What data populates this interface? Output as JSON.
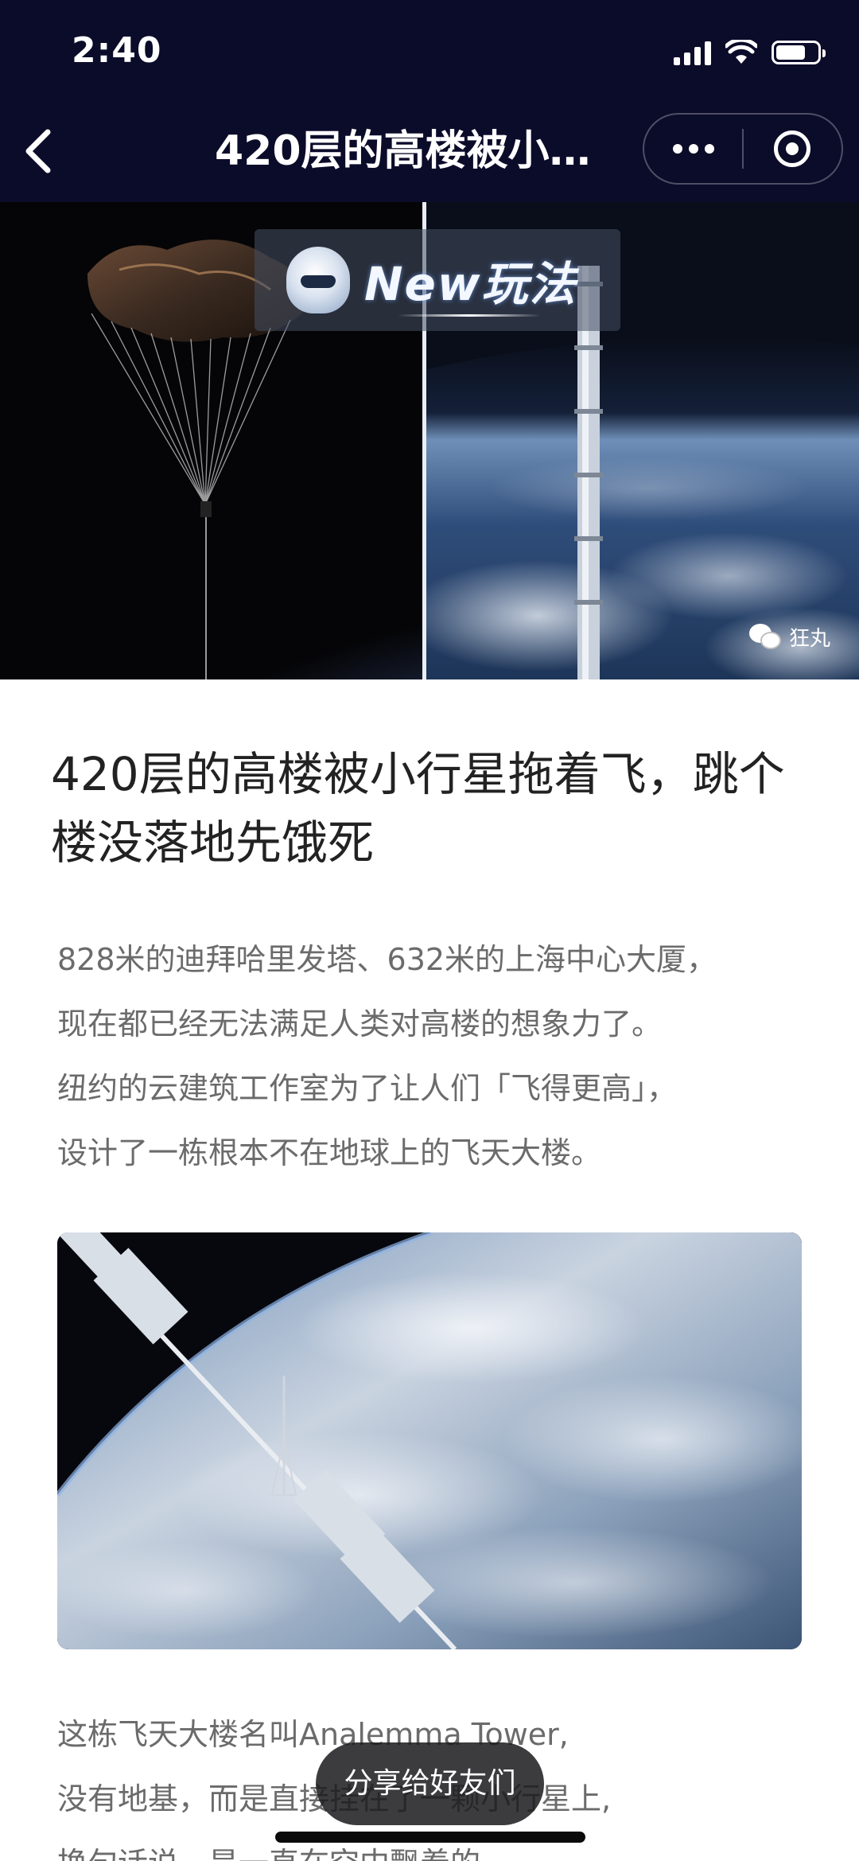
{
  "status_bar": {
    "time": "2:40",
    "icons": [
      "cellular-signal-icon",
      "wifi-icon",
      "battery-icon"
    ]
  },
  "nav": {
    "back_icon": "chevron-left-icon",
    "title": "420层的高楼被小…",
    "more_icon": "more-dots-icon",
    "close_icon": "target-circle-icon"
  },
  "hero": {
    "badge_text": "New玩法",
    "watermark": "狂丸"
  },
  "article": {
    "title": "420层的高楼被小行星拖着飞，跳个楼没落地先饿死",
    "paragraph1": [
      "828米的迪拜哈里发塔、632米的上海中心大厦，",
      "现在都已经无法满足人类对高楼的想象力了。",
      "纽约的云建筑工作室为了让人们「飞得更高」，",
      "设计了一栋根本不在地球上的飞天大楼。"
    ],
    "paragraph2": [
      "这栋飞天大楼名叫Analemma Tower,",
      "没有地基，而是直接挂在了一颗小行星上,",
      "换句话说，是一直在空中飘着的。"
    ]
  },
  "toast": {
    "label": "分享给好友们"
  },
  "colors": {
    "nav_background": "#0b0b2a",
    "title_text": "#222222",
    "body_text": "#6b6b6b",
    "toast_background": "#1c1c1e"
  }
}
